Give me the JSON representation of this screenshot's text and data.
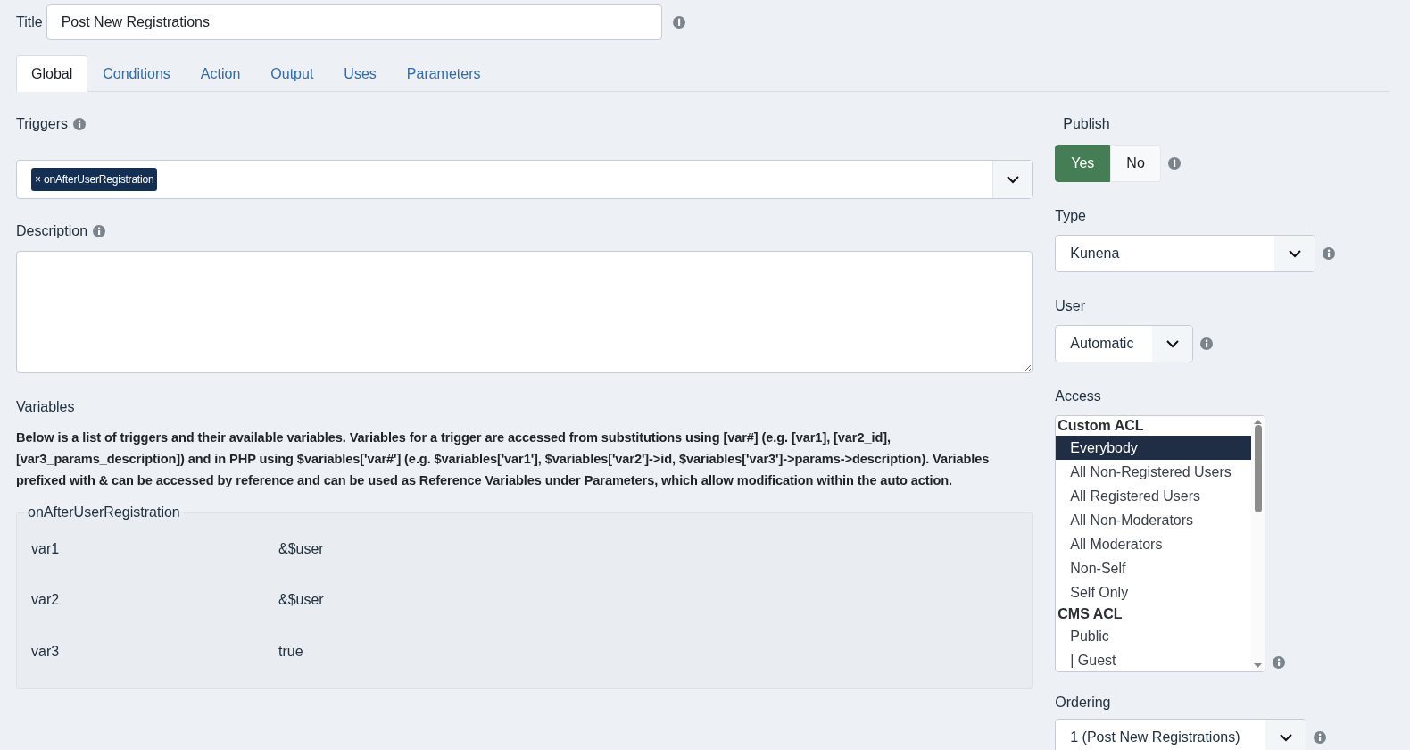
{
  "title_field": {
    "label": "Title",
    "value": "Post New Registrations"
  },
  "tabs": [
    {
      "label": "Global",
      "selected": true
    },
    {
      "label": "Conditions",
      "selected": false
    },
    {
      "label": "Action",
      "selected": false
    },
    {
      "label": "Output",
      "selected": false
    },
    {
      "label": "Uses",
      "selected": false
    },
    {
      "label": "Parameters",
      "selected": false
    }
  ],
  "triggers": {
    "label": "Triggers",
    "tags": [
      "onAfterUserRegistration"
    ],
    "remove_mark": "×"
  },
  "description": {
    "label": "Description"
  },
  "variables": {
    "label": "Variables",
    "help": "Below is a list of triggers and their available variables. Variables for a trigger are accessed from substitutions using [var#] (e.g. [var1], [var2_id], [var3_params_description]) and in PHP using $variables['var#'] (e.g. $variables['var1'], $variables['var2']->id, $variables['var3']->params->description). Variables prefixed with & can be accessed by reference and can be used as Reference Variables under Parameters, which allow modification within the auto action.",
    "groups": [
      {
        "legend": "onAfterUserRegistration",
        "rows": [
          {
            "name": "var1",
            "value": "&$user"
          },
          {
            "name": "var2",
            "value": "&$user"
          },
          {
            "name": "var3",
            "value": "true"
          }
        ]
      }
    ]
  },
  "publish": {
    "label": "Publish",
    "options": [
      {
        "label": "Yes",
        "selected": true
      },
      {
        "label": "No",
        "selected": false
      }
    ]
  },
  "type": {
    "label": "Type",
    "value": "Kunena"
  },
  "user": {
    "label": "User",
    "value": "Automatic"
  },
  "access": {
    "label": "Access",
    "items": [
      {
        "kind": "group",
        "label": "Custom ACL"
      },
      {
        "kind": "option",
        "label": "Everybody",
        "selected": true
      },
      {
        "kind": "option",
        "label": "All Non-Registered Users",
        "selected": false
      },
      {
        "kind": "option",
        "label": "All Registered Users",
        "selected": false
      },
      {
        "kind": "option",
        "label": "All Non-Moderators",
        "selected": false
      },
      {
        "kind": "option",
        "label": "All Moderators",
        "selected": false
      },
      {
        "kind": "option",
        "label": "Non-Self",
        "selected": false
      },
      {
        "kind": "option",
        "label": "Self Only",
        "selected": false
      },
      {
        "kind": "group",
        "label": "CMS ACL"
      },
      {
        "kind": "option",
        "label": "Public",
        "selected": false
      },
      {
        "kind": "option",
        "label": "| Guest",
        "selected": false
      }
    ]
  },
  "ordering": {
    "label": "Ordering",
    "value": "1 (Post New Registrations)"
  }
}
